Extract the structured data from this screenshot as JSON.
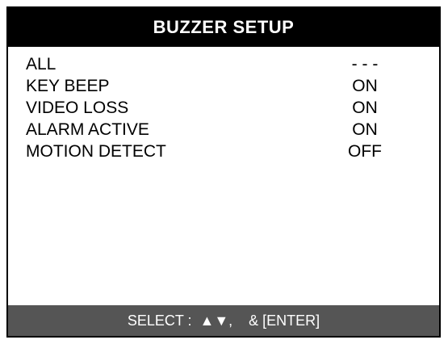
{
  "menu": {
    "title": "BUZZER SETUP",
    "options": [
      {
        "label": "ALL",
        "value": "- - -"
      },
      {
        "label": "KEY BEEP",
        "value": "ON"
      },
      {
        "label": "VIDEO LOSS",
        "value": "ON"
      },
      {
        "label": "ALARM ACTIVE",
        "value": "ON"
      },
      {
        "label": "MOTION DETECT",
        "value": "OFF"
      }
    ]
  },
  "footer": {
    "hint": "SELECT :  ▲▼,    & [ENTER]"
  },
  "colors": {
    "title_background": "#000000",
    "title_text": "#ffffff",
    "footer_background": "#555555",
    "footer_text": "#ffffff",
    "body_background": "#ffffff",
    "body_text": "#000000"
  }
}
